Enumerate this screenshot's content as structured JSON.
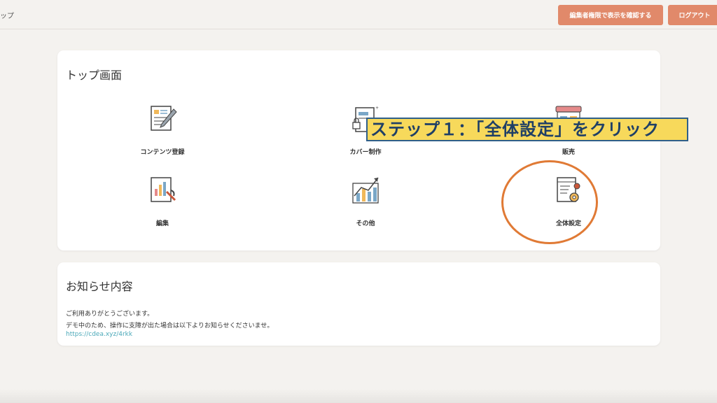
{
  "header": {
    "title": "ップ",
    "preview_button": "編集者権限で表示を確認する",
    "logout_button": "ログアウト"
  },
  "top_card": {
    "title": "トップ画面",
    "tiles": [
      {
        "label": "コンテンツ登録",
        "icon": "document-pen-icon"
      },
      {
        "label": "カバー制作",
        "icon": "cover-lock-icon"
      },
      {
        "label": "販売",
        "icon": "shop-icon"
      },
      {
        "label": "編集",
        "icon": "chart-edit-icon"
      },
      {
        "label": "その他",
        "icon": "growth-chart-icon"
      },
      {
        "label": "全体設定",
        "icon": "settings-gear-icon"
      }
    ]
  },
  "news_card": {
    "title": "お知らせ内容",
    "line1": "ご利用ありがとうございます。",
    "line2": "デモ中のため、操作に支障が出た場合は以下よりお知らせくださいませ。",
    "link": "https://cdea.xyz/4rkk"
  },
  "annotation": {
    "text": "ステップ１：「全体設定」をクリック"
  },
  "colors": {
    "background": "#f4f2ef",
    "button": "#e1896a",
    "annotation_bg": "#f7d95b",
    "annotation_text": "#1f3f66",
    "highlight_circle": "#e07a35",
    "link": "#4aa8b8"
  }
}
